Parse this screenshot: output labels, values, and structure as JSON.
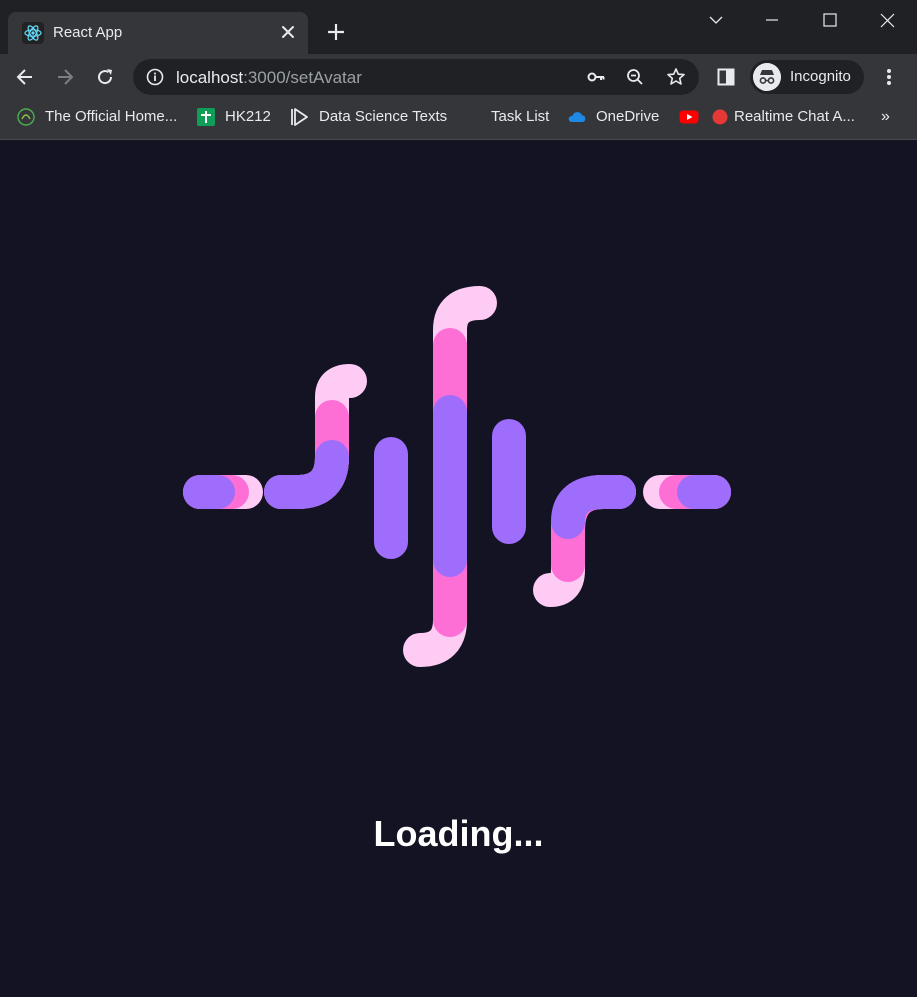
{
  "browser": {
    "tab": {
      "title": "React App",
      "favicon": "react-icon",
      "close_icon": "close-icon"
    },
    "new_tab_icon": "plus-icon",
    "window_controls": [
      "chevron-down-icon",
      "minimize-icon",
      "maximize-icon",
      "close-icon"
    ],
    "url": {
      "host": "localhost",
      "rest": ":3000/setAvatar"
    },
    "omnibox_icons": [
      "key-icon",
      "zoom-out-icon",
      "star-icon"
    ],
    "incognito_label": "Incognito",
    "bookmarks": [
      {
        "label": "The Official Home...",
        "icon": "sprout-icon"
      },
      {
        "label": "HK212",
        "icon": "sheets-icon"
      },
      {
        "label": "Data Science Texts",
        "icon": "play-outline-icon"
      },
      {
        "label": "Task List",
        "icon": ""
      },
      {
        "label": "OneDrive",
        "icon": "cloud-icon"
      },
      {
        "label": "",
        "icon": "youtube-icon"
      },
      {
        "label": "Realtime Chat A...",
        "icon": "red-dot-icon"
      }
    ],
    "bookmarks_overflow": "»"
  },
  "page": {
    "loading_text": "Loading...",
    "loader_icon": "audio-wave-loader-icon",
    "colors": {
      "background": "#131324",
      "purple": "#9e6dfc",
      "pink": "#fe6fd5",
      "light_pink": "#fecbf5"
    }
  }
}
